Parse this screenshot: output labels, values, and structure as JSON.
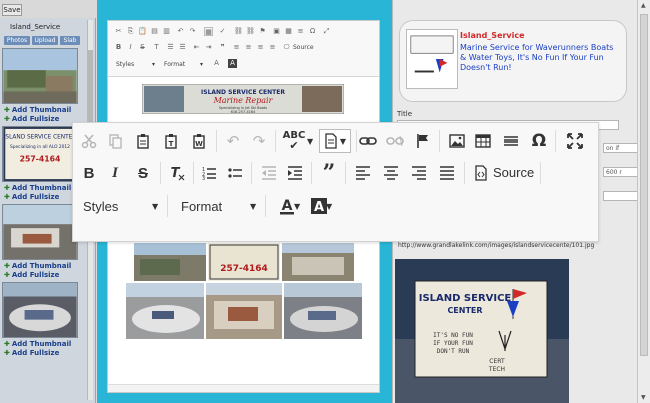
{
  "left_panel": {
    "save_label": "Save",
    "folder_title": "Island_Service",
    "tabs": [
      "Photos",
      "Upload",
      "Slab"
    ],
    "thumb_items": [
      {
        "link1": "Add Thumbnail",
        "link2": "Add Fullsize"
      },
      {
        "link1": "Add Thumbnail",
        "link2": "Add Fullsize"
      },
      {
        "link1": "Add Thumbnail",
        "link2": "Add Fullsize"
      },
      {
        "link1": "Add Thumbnail",
        "link2": "Add Fullsize"
      }
    ],
    "thumb2_text": {
      "line1": "ISLAND SERVICE CENTER",
      "line2": "Specializing in all ALO 2012",
      "line3": "257-4164"
    }
  },
  "editor": {
    "mini_source_label": "Source",
    "mini_styles": "Styles",
    "mini_format": "Format",
    "banner": {
      "line1": "ISLAND SERVICE CENTER",
      "line2": "Marine Repair",
      "line3": "Specializing in Jet Ski Boats",
      "line4": "618-257-4164"
    },
    "photo_phone": "257-4164"
  },
  "toolbar": {
    "source_label": "Source",
    "styles_label": "Styles",
    "format_label": "Format",
    "spellcheck_label": "ABC"
  },
  "right_panel": {
    "card_title": "Island_Service",
    "card_description": "Marine Service for Waverunners Boats & Water Toys, It's No Fun If Your Fun Doesn't Run!",
    "title_label": "Title",
    "field_value_1": "on if",
    "field_value_2": "600 r",
    "url": "http://www.grandlakelink.com/images/islandservicecente/101.jpg",
    "image_text": {
      "line1": "ISLAND SERVICE",
      "line2": "CENTER",
      "line3": "IT'S NO FUN",
      "line4": "IF YOUR FUN",
      "line5": "DON'T RUN",
      "line6": "CERT",
      "line7": "TECH"
    }
  },
  "colors": {
    "frame_blue": "#29b5d6",
    "card_title_red": "#d22828",
    "card_desc_blue": "#1a3fc2",
    "link_blue": "#1a3f8a"
  }
}
